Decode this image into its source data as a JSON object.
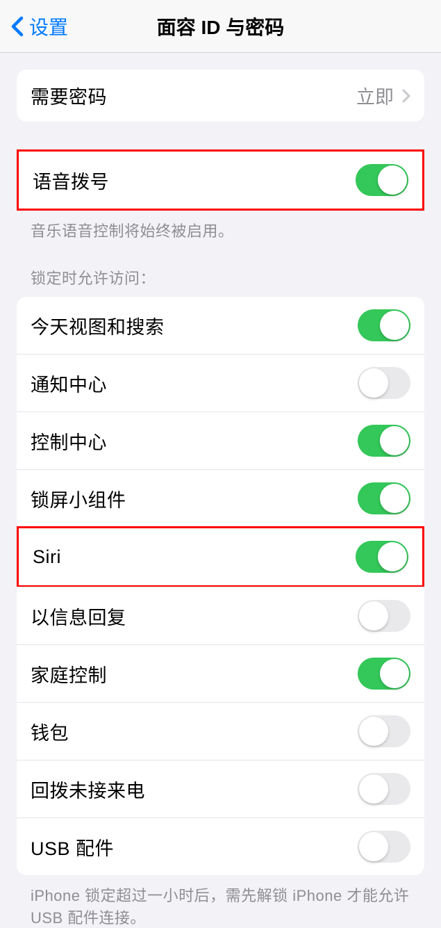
{
  "header": {
    "back_label": "设置",
    "title": "面容 ID 与密码"
  },
  "require_passcode": {
    "label": "需要密码",
    "value": "立即"
  },
  "voice_dial": {
    "label": "语音拨号",
    "on": true,
    "footer": "音乐语音控制将始终被启用。"
  },
  "lock_access": {
    "header": "锁定时允许访问：",
    "items": [
      {
        "label": "今天视图和搜索",
        "on": true
      },
      {
        "label": "通知中心",
        "on": false
      },
      {
        "label": "控制中心",
        "on": true
      },
      {
        "label": "锁屏小组件",
        "on": true
      },
      {
        "label": "Siri",
        "on": true,
        "highlighted": true
      },
      {
        "label": "以信息回复",
        "on": false
      },
      {
        "label": "家庭控制",
        "on": true
      },
      {
        "label": "钱包",
        "on": false
      },
      {
        "label": "回拨未接来电",
        "on": false
      },
      {
        "label": "USB 配件",
        "on": false
      }
    ],
    "footer": "iPhone 锁定超过一小时后，需先解锁 iPhone 才能允许 USB 配件连接。"
  }
}
